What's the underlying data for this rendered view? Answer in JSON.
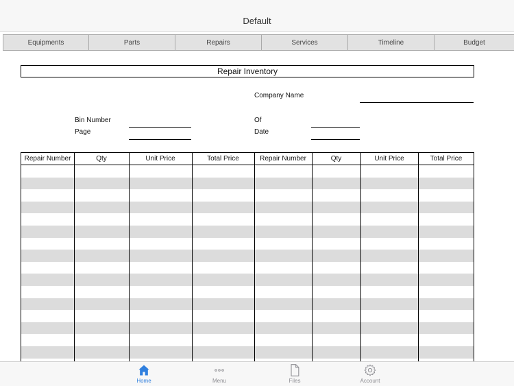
{
  "app": {
    "title": "Default"
  },
  "tabs": [
    "Equipments",
    "Parts",
    "Repairs",
    "Services",
    "Timeline",
    "Budget"
  ],
  "form": {
    "title": "Repair Inventory",
    "company_label": "Company Name",
    "bin_label": "Bin Number",
    "page_label": "Page",
    "of_label": "Of",
    "date_label": "Date"
  },
  "table": {
    "columns": [
      "Repair Number",
      "Qty",
      "Unit Price",
      "Total Price",
      "Repair Number",
      "Qty",
      "Unit Price",
      "Total Price"
    ]
  },
  "tabbar": {
    "home": "Home",
    "menu": "Menu",
    "files": "Files",
    "account": "Account"
  },
  "colors": {
    "accent": "#2f7fde",
    "inactive": "#8e8e93",
    "band": "#dcdcdc"
  }
}
